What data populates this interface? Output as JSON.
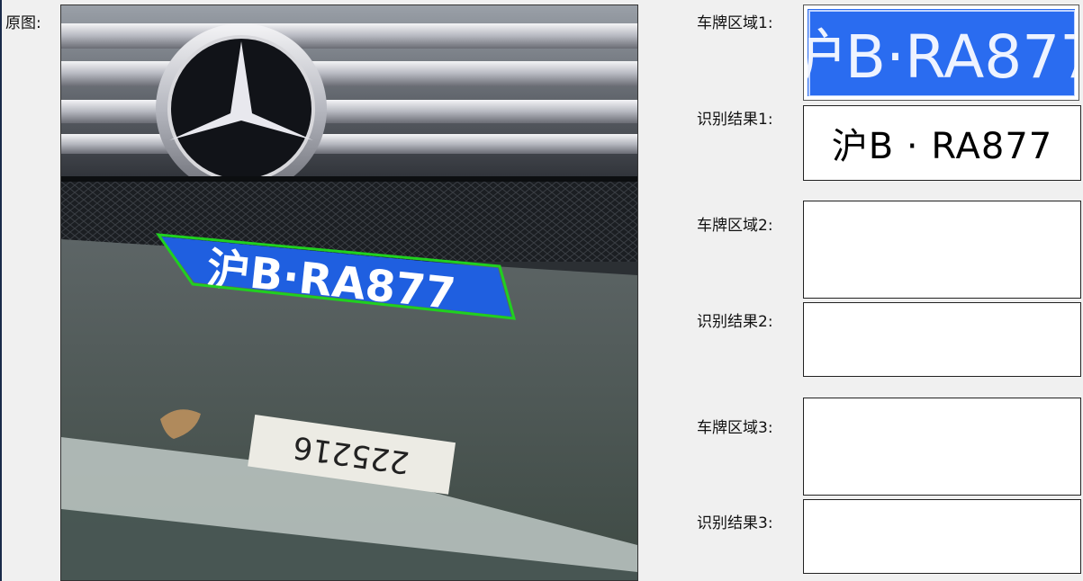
{
  "labels": {
    "original": "原图:",
    "plate_region_1": "车牌区域1:",
    "result_1": "识别结果1:",
    "plate_region_2": "车牌区域2:",
    "result_2": "识别结果2:",
    "plate_region_3": "车牌区域3:",
    "result_3": "识别结果3:"
  },
  "results": {
    "r1": "沪B · RA877",
    "r2": "",
    "r3": ""
  },
  "image": {
    "plate_text": "沪B·RA877",
    "ground_number": "225216"
  },
  "colors": {
    "plate_blue": "#1f5fe0",
    "detection_box": "#20d020",
    "window_bg": "#f0f0f0"
  }
}
